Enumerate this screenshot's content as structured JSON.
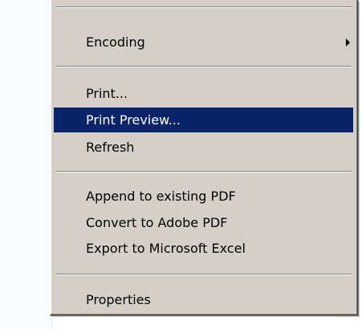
{
  "menu": {
    "items": [
      {
        "id": "encoding",
        "label": "Encoding",
        "has_submenu": true
      },
      {
        "id": "print",
        "label": "Print..."
      },
      {
        "id": "print-preview",
        "label": "Print Preview...",
        "highlighted": true
      },
      {
        "id": "refresh",
        "label": "Refresh"
      },
      {
        "id": "append-pdf",
        "label": "Append to existing PDF"
      },
      {
        "id": "convert-pdf",
        "label": "Convert to Adobe PDF"
      },
      {
        "id": "export-excel",
        "label": "Export to Microsoft Excel"
      },
      {
        "id": "properties",
        "label": "Properties"
      }
    ]
  },
  "colors": {
    "menu_background": "#d4d0c8",
    "highlight_background": "#0a246a",
    "highlight_text": "#ffffff",
    "text": "#000000"
  }
}
